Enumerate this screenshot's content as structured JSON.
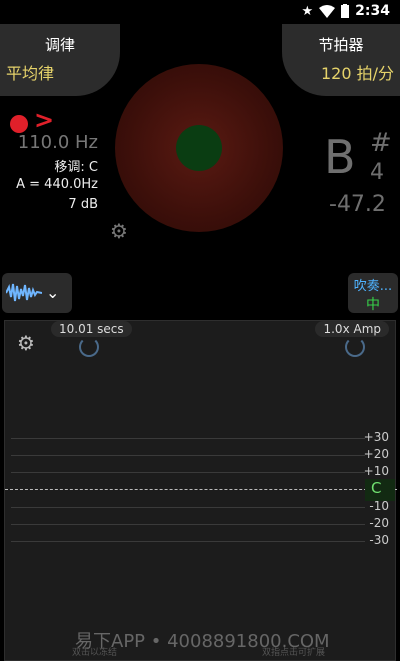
{
  "status_bar": {
    "time": "2:34",
    "icons": [
      "star-icon",
      "wifi-icon",
      "battery-icon"
    ]
  },
  "temperament": {
    "title": "调律",
    "value": "平均律"
  },
  "metronome": {
    "title": "节拍器",
    "value": "120 拍/分"
  },
  "tuner": {
    "frequency": "110.0 Hz",
    "transpose": "移调: C",
    "reference": "A = 440.0Hz",
    "gain": "7 dB",
    "note": "B",
    "accidental": "#",
    "octave": "4",
    "cents": "-47.2"
  },
  "instrument": {
    "label": "吹奏...",
    "value": "中"
  },
  "graph": {
    "time_span": "10.01 secs",
    "amp": "1.0x Amp",
    "scale": [
      "+30",
      "+20",
      "+10",
      "-10",
      "-20",
      "-30"
    ],
    "center_note": "C"
  },
  "hints": {
    "left": "双击以冻结",
    "right": "双指点击可扩展"
  },
  "watermark": "易下APP • 4008891800.COM",
  "colors": {
    "accent_gold": "#e6d36a",
    "record_red": "#e0202a",
    "in_tune_green": "#37d24a",
    "label_blue": "#4fb3ff"
  }
}
